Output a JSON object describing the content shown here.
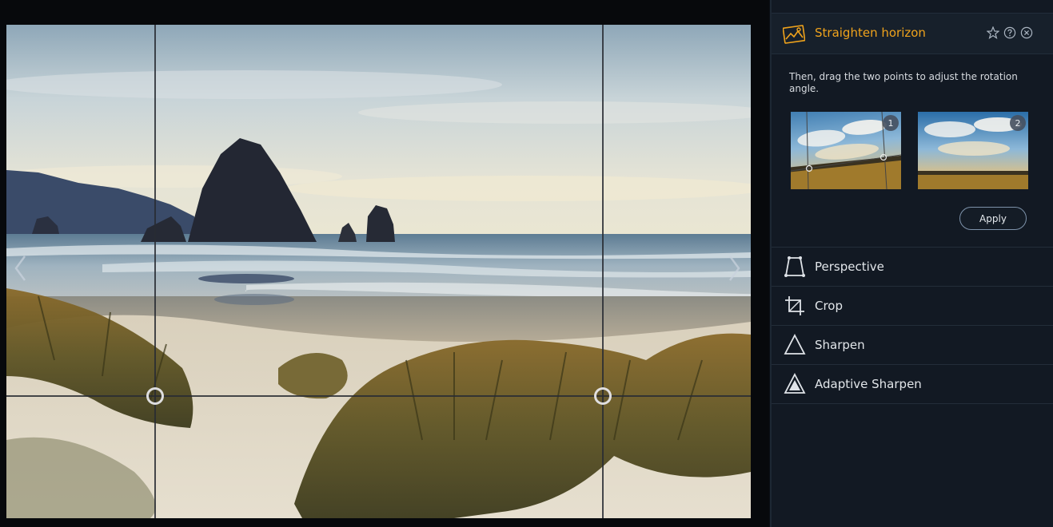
{
  "panel": {
    "title": "Straighten horizon",
    "instructions": "Then, drag the two points to adjust the rotation angle.",
    "thumbnails": [
      {
        "badge": "1"
      },
      {
        "badge": "2"
      }
    ],
    "apply_label": "Apply",
    "tools": [
      {
        "label": "Perspective",
        "icon": "perspective-icon"
      },
      {
        "label": "Crop",
        "icon": "crop-icon"
      },
      {
        "label": "Sharpen",
        "icon": "sharpen-icon"
      },
      {
        "label": "Adaptive Sharpen",
        "icon": "adaptive-sharpen-icon"
      }
    ]
  },
  "header_icons": [
    "favorite-star-icon",
    "help-icon",
    "close-icon"
  ],
  "canvas": {
    "nav_icons": [
      "previous-arrow-icon",
      "next-arrow-icon"
    ],
    "photo": "beach-haystack-rock-photo"
  },
  "colors": {
    "accent": "#f0a31c",
    "panel_bg": "#121923",
    "header_bg": "#17202b",
    "canvas_bg": "#07090c",
    "apply_border": "#7d92aa"
  }
}
